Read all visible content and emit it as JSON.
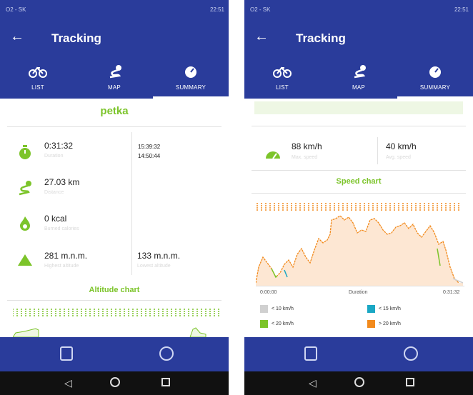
{
  "status": {
    "carrier": "O2 - SK",
    "clock": "22:51"
  },
  "app": {
    "title": "Tracking",
    "tabs": [
      {
        "label": "LIST",
        "icon": "bike-icon"
      },
      {
        "label": "MAP",
        "icon": "route-icon"
      },
      {
        "label": "SUMMARY",
        "icon": "speedometer-icon"
      }
    ],
    "active_tab": "SUMMARY"
  },
  "left_screen": {
    "track_name": "petka",
    "stats": {
      "duration_value": "0:31:32",
      "duration_label": "Duration",
      "start_time": "15:39:32",
      "end_time": "14:50:44",
      "distance_value": "27.03 km",
      "distance_label": "Distance",
      "calories_value": "0 kcal",
      "calories_label": "Burned calories",
      "highest_value": "281 m.n.m.",
      "highest_label": "Highest altitude",
      "lowest_value": "133 m.n.m.",
      "lowest_label": "Lowest altitude"
    },
    "chart_title": "Altitude chart"
  },
  "right_screen": {
    "max_speed_value": "88 km/h",
    "max_speed_label": "Max. speed",
    "avg_speed_value": "40 km/h",
    "avg_speed_label": "Avg. speed",
    "chart_title": "Speed chart",
    "axis_start": "0:00:00",
    "axis_mid": "Duration",
    "axis_end": "0:31:32",
    "legend": [
      {
        "label": "< 10 km/h",
        "color": "#d0d0d0"
      },
      {
        "label": "< 15 km/h",
        "color": "#1aa7c4"
      },
      {
        "label": "< 20 km/h",
        "color": "#7cc42a"
      },
      {
        "label": "> 20 km/h",
        "color": "#f28a1c"
      }
    ]
  },
  "colors": {
    "primary": "#2a3c9b",
    "accent_green": "#7cc42a",
    "accent_orange": "#f28a1c"
  }
}
